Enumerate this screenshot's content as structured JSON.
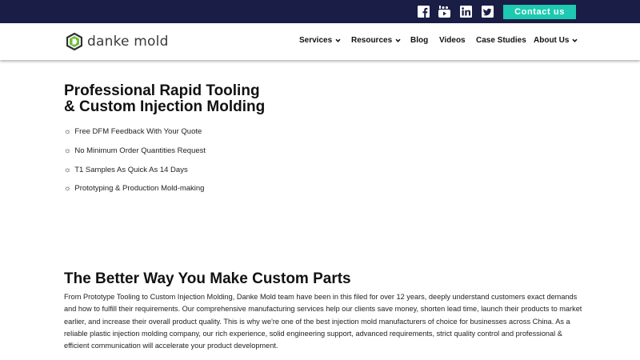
{
  "topbar": {
    "social": [
      "facebook-icon",
      "youtube-icon",
      "linkedin-icon",
      "twitter-icon"
    ],
    "contact_label": "Contact us",
    "colors": {
      "background": "#1a1d45",
      "accent": "#1dc9b0"
    }
  },
  "header": {
    "logo_text": "danke mold",
    "nav": [
      {
        "label": "Services",
        "dropdown": true
      },
      {
        "label": "Resources",
        "dropdown": true
      },
      {
        "label": "Blog",
        "dropdown": false
      },
      {
        "label": "Videos",
        "dropdown": false
      },
      {
        "label": "Case Studies",
        "dropdown": false
      },
      {
        "label": "About Us",
        "dropdown": true
      }
    ]
  },
  "hero": {
    "title_line1": "Professional Rapid Tooling",
    "title_line2": "& Custom Injection Molding",
    "bullet_glyph": "☼",
    "features": [
      "Free DFM Feedback With Your Quote",
      "No Minimum Order Quantities Request",
      "T1 Samples As Quick As 14 Days",
      "Prototyping & Production Mold-making"
    ]
  },
  "intro": {
    "heading": "The Better Way You Make Custom Parts",
    "body": "From Prototype Tooling to Custom Injection Molding, Danke Mold team have been in this filed for over 12 years, deeply understand customers exact demands and how to fulfill their requirements. Our comprehensive manufacturing services help our clients save money, shorten lead time, launch their products to market earlier, and increase their overall product quality. This is why we're one of the best injection mold manufacturers of choice for businesses across China. As a reliable plastic injection molding company, our rich experience, solid engineering support, advanced requirements, strict quality control and professional & efficient communication will accelerate your product development."
  }
}
